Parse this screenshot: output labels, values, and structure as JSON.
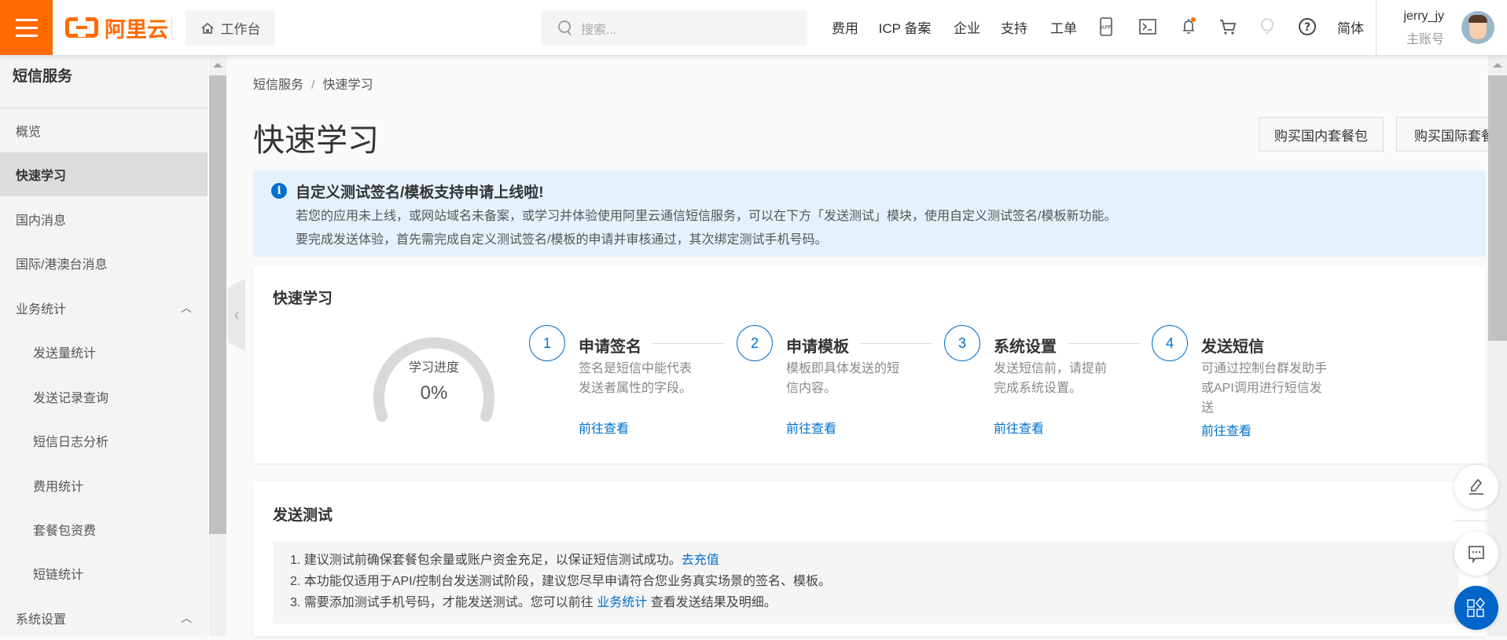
{
  "header": {
    "logo_text": "阿里云",
    "workbench": "工作台",
    "search_placeholder": "搜索...",
    "nav": [
      "费用",
      "ICP 备案",
      "企业",
      "支持",
      "工单"
    ],
    "icons": [
      "app-icon",
      "terminal-icon",
      "bell-icon",
      "cart-icon",
      "lightbulb-icon",
      "help-icon"
    ],
    "language": "简体",
    "username": "jerry_jy",
    "account_type": "主账号"
  },
  "sidebar": {
    "title": "短信服务",
    "items": [
      {
        "label": "概览"
      },
      {
        "label": "快速学习"
      },
      {
        "label": "国内消息"
      },
      {
        "label": "国际/港澳台消息"
      },
      {
        "label": "业务统计"
      },
      {
        "label": "发送量统计"
      },
      {
        "label": "发送记录查询"
      },
      {
        "label": "短信日志分析"
      },
      {
        "label": "费用统计"
      },
      {
        "label": "套餐包资费"
      },
      {
        "label": "短链统计"
      },
      {
        "label": "系统设置"
      }
    ]
  },
  "breadcrumb": [
    "短信服务",
    "快速学习"
  ],
  "breadcrumb_sep": "/",
  "page_title": "快速学习",
  "buttons": {
    "buy_domestic": "购买国内套餐包",
    "buy_international": "购买国际套餐包"
  },
  "alert": {
    "title": "自定义测试签名/模板支持申请上线啦!",
    "line1": "若您的应用未上线，或网站域名未备案，或学习并体验使用阿里云通信短信服务，可以在下方「发送测试」模块，使用自定义测试签名/模板新功能。",
    "line2": "要完成发送体验，首先需完成自定义测试签名/模板的申请并审核通过，其次绑定测试手机号码。"
  },
  "quick_learn": {
    "title": "快速学习",
    "progress_label": "学习进度",
    "progress_text": "0%",
    "progress_value": 0,
    "steps": [
      {
        "num": "1",
        "title": "申请签名",
        "desc": "签名是短信中能代表发送者属性的字段。",
        "link": "前往查看"
      },
      {
        "num": "2",
        "title": "申请模板",
        "desc": "模板即具体发送的短信内容。",
        "link": "前往查看"
      },
      {
        "num": "3",
        "title": "系统设置",
        "desc": "发送短信前，请提前完成系统设置。",
        "link": "前往查看"
      },
      {
        "num": "4",
        "title": "发送短信",
        "desc": "可通过控制台群发助手或API调用进行短信发送",
        "link": "前往查看"
      }
    ]
  },
  "send_test": {
    "title": "发送测试",
    "note1": "1. 建议测试前确保套餐包余量或账户资金充足，以保证短信测试成功。",
    "note1_link": "去充值",
    "note2": "2. 本功能仅适用于API/控制台发送测试阶段，建议您尽早申请符合您业务真实场景的签名、模板。",
    "note3_pre": "3. 需要添加测试手机号码，才能发送测试。您可以前往 ",
    "note3_link": "业务统计",
    "note3_post": " 查看发送结果及明细。"
  },
  "colors": {
    "brand": "#ff6a00",
    "link": "#0070cc",
    "alert_bg": "#e5f2fd"
  }
}
